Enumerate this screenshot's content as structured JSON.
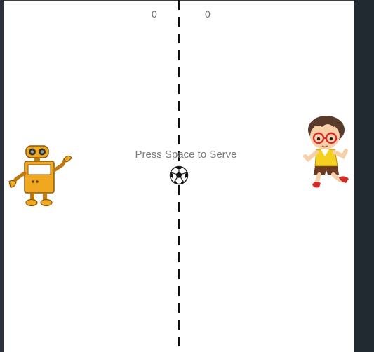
{
  "scoreboard": {
    "left_score": "0",
    "right_score": "0"
  },
  "message": {
    "serve": "Press Space to Serve"
  },
  "colors": {
    "court": "#ffffff",
    "frame": "#2a3138",
    "net": "#111111",
    "score": "#6c6c6c",
    "robot": "#f0a820",
    "kid_shirt": "#f5d020",
    "kid_shorts": "#6b3a1f",
    "kid_shoes": "#d42a2a"
  },
  "icons": {
    "ball": "soccer-ball-icon",
    "left_paddle": "robot-paddle-icon",
    "right_paddle": "kid-paddle-icon"
  }
}
